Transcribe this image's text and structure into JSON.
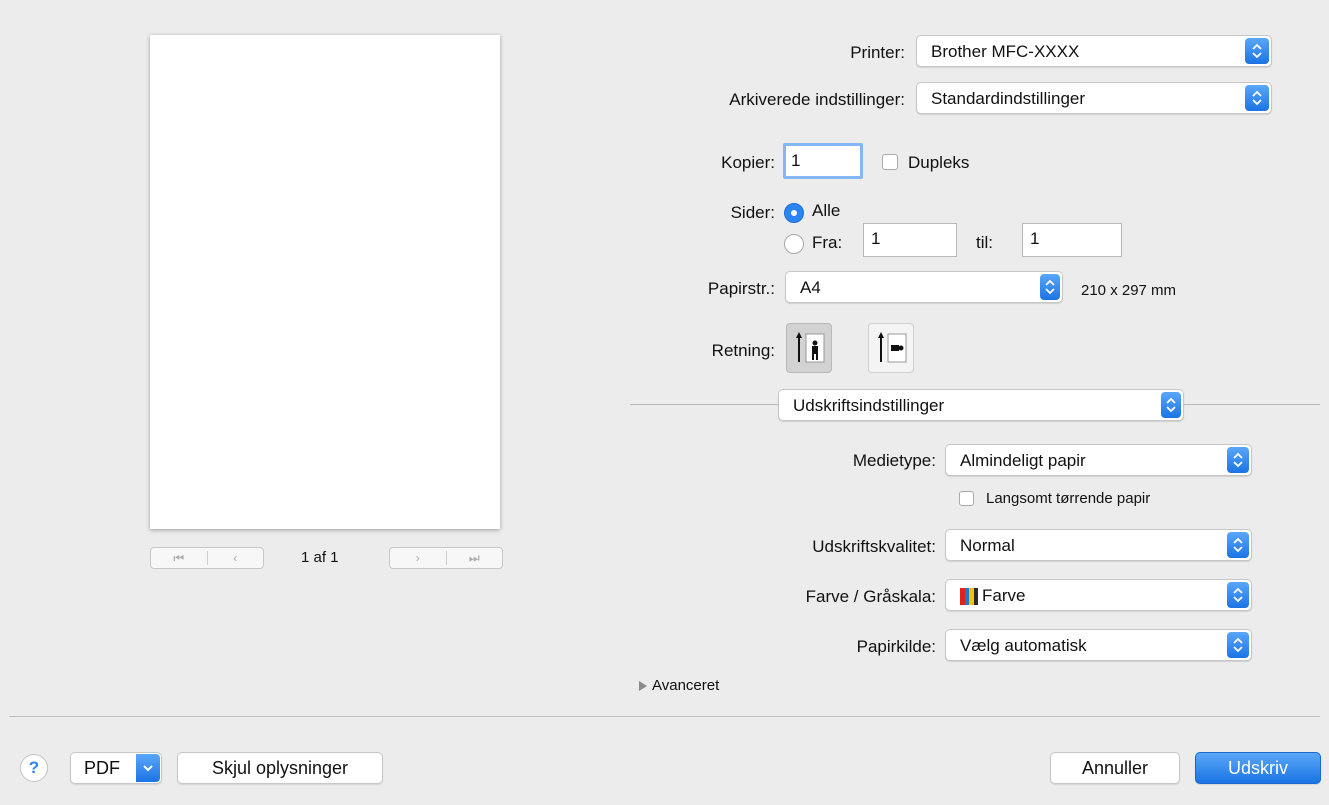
{
  "preview": {
    "page_count": "1 af 1",
    "nav_first": "⏮",
    "nav_prev": "‹",
    "nav_next": "›",
    "nav_last": "⏭"
  },
  "printer": {
    "label": "Printer:",
    "value": "Brother MFC-XXXX"
  },
  "presets": {
    "label": "Arkiverede indstillinger:",
    "value": "Standardindstillinger"
  },
  "copies": {
    "label": "Kopier:",
    "value": "1",
    "duplex_label": "Dupleks",
    "duplex_checked": false
  },
  "pages": {
    "label": "Sider:",
    "all_label": "Alle",
    "from_label": "Fra:",
    "from_value": "1",
    "to_label": "til:",
    "to_value": "1",
    "selected": "all"
  },
  "paper_size": {
    "label": "Papirstr.:",
    "value": "A4",
    "dimensions": "210 x 297 mm"
  },
  "orientation": {
    "label": "Retning:",
    "selected": "portrait"
  },
  "section": {
    "value": "Udskriftsindstillinger"
  },
  "media_type": {
    "label": "Medietype:",
    "value": "Almindeligt papir",
    "slow_dry_label": "Langsomt tørrende papir",
    "slow_dry_checked": false
  },
  "print_quality": {
    "label": "Udskriftskvalitet:",
    "value": "Normal"
  },
  "color_mode": {
    "label": "Farve / Gråskala:",
    "value": "Farve",
    "swatch_colors": [
      "#e2231a",
      "#1a7bd5",
      "#f6c300",
      "#2a2a2a"
    ]
  },
  "paper_source": {
    "label": "Papirkilde:",
    "value": "Vælg automatisk"
  },
  "advanced": {
    "label": "Avanceret"
  },
  "footer": {
    "help": "?",
    "pdf": "PDF",
    "hide_details": "Skjul oplysninger",
    "cancel": "Annuller",
    "print": "Udskriv"
  },
  "colors": {
    "accent": "#2b84f3",
    "background": "#ececec"
  }
}
